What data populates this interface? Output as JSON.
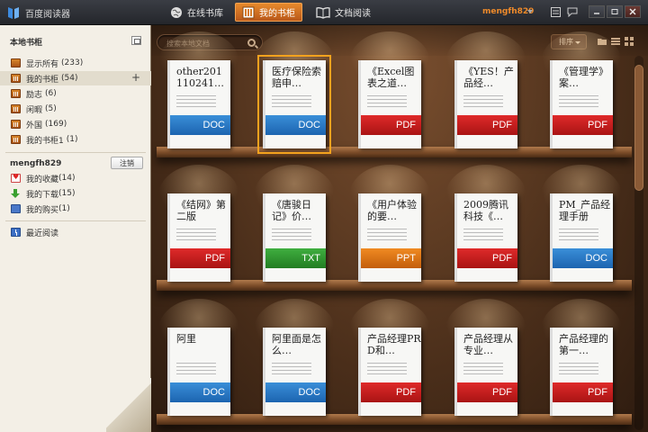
{
  "app": {
    "title": "百度阅读器"
  },
  "nav": [
    {
      "label": "在线书库"
    },
    {
      "label": "我的书柜"
    },
    {
      "label": "文档阅读"
    }
  ],
  "user": {
    "name": "mengfh829"
  },
  "sidebar": {
    "local_title": "本地书柜",
    "items": [
      {
        "label": "显示所有",
        "count": "(233)"
      },
      {
        "label": "我的书柜",
        "count": "(54)"
      },
      {
        "label": "励志",
        "count": "(6)"
      },
      {
        "label": "闲暇",
        "count": "(5)"
      },
      {
        "label": "外国",
        "count": "(169)"
      },
      {
        "label": "我的书柜1",
        "count": "(1)"
      }
    ],
    "logout_label": "注销",
    "account_items": [
      {
        "label": "我的收藏",
        "count": "(14)"
      },
      {
        "label": "我的下载",
        "count": "(15)"
      },
      {
        "label": "我的购买",
        "count": "(1)"
      }
    ],
    "recent_label": "最近阅读"
  },
  "toolbar": {
    "search_placeholder": "搜索本地文档",
    "sort_label": "排序"
  },
  "colors": {
    "accent": "#e78a2c",
    "doc": "#1c64b0",
    "pdf": "#c81d1d",
    "txt": "#2f962f",
    "ppt": "#e07417"
  },
  "books": [
    {
      "title": "other201 110241…",
      "type": "DOC"
    },
    {
      "title": "医疗保险索赔申…",
      "type": "DOC"
    },
    {
      "title": "《Excel图表之道…",
      "type": "PDF"
    },
    {
      "title": "《YES！产品经…",
      "type": "PDF"
    },
    {
      "title": "《管理学》案…",
      "type": "PDF"
    },
    {
      "title": "《结网》第二版",
      "type": "PDF"
    },
    {
      "title": "《唐骏日记》价…",
      "type": "TXT"
    },
    {
      "title": "《用户体验的要…",
      "type": "PPT"
    },
    {
      "title": "2009腾讯科技《…",
      "type": "PDF"
    },
    {
      "title": "PM_产品经理手册",
      "type": "DOC"
    },
    {
      "title": "阿里",
      "type": "DOC"
    },
    {
      "title": "阿里面是怎么…",
      "type": "DOC"
    },
    {
      "title": "产品经理PRD和…",
      "type": "PDF"
    },
    {
      "title": "产品经理从专业…",
      "type": "PDF"
    },
    {
      "title": "产品经理的第一…",
      "type": "PDF"
    }
  ]
}
